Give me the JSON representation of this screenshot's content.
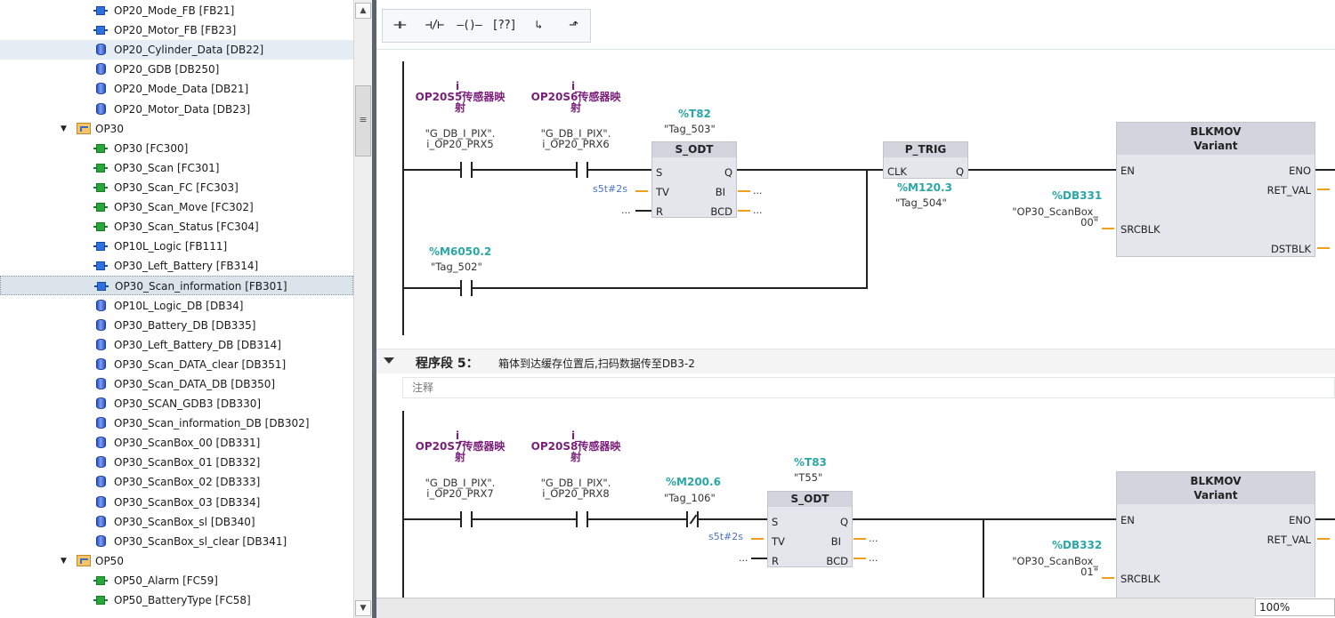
{
  "tree": {
    "items": [
      {
        "label": "OP20_Mode_FB [FB21]",
        "kind": "fb",
        "indent": 1
      },
      {
        "label": "OP20_Motor_FB [FB23]",
        "kind": "fb",
        "indent": 1
      },
      {
        "label": "OP20_Cylinder_Data [DB22]",
        "kind": "db",
        "indent": 1,
        "state": "selected-light"
      },
      {
        "label": "OP20_GDB [DB250]",
        "kind": "db",
        "indent": 1
      },
      {
        "label": "OP20_Mode_Data [DB21]",
        "kind": "db",
        "indent": 1
      },
      {
        "label": "OP20_Motor_Data [DB23]",
        "kind": "db",
        "indent": 1
      },
      {
        "label": "OP30",
        "kind": "folder",
        "indent": 0,
        "expanded": true
      },
      {
        "label": "OP30 [FC300]",
        "kind": "fc",
        "indent": 1
      },
      {
        "label": "OP30_Scan [FC301]",
        "kind": "fc",
        "indent": 1
      },
      {
        "label": "OP30_Scan_FC [FC303]",
        "kind": "fc",
        "indent": 1
      },
      {
        "label": "OP30_Scan_Move [FC302]",
        "kind": "fc",
        "indent": 1
      },
      {
        "label": "OP30_Scan_Status [FC304]",
        "kind": "fc",
        "indent": 1
      },
      {
        "label": "OP10L_Logic [FB111]",
        "kind": "fb",
        "indent": 1
      },
      {
        "label": "OP30_Left_Battery [FB314]",
        "kind": "fb",
        "indent": 1
      },
      {
        "label": "OP30_Scan_information [FB301]",
        "kind": "fb",
        "indent": 1,
        "state": "selected"
      },
      {
        "label": "OP10L_Logic_DB [DB34]",
        "kind": "db",
        "indent": 1
      },
      {
        "label": "OP30_Battery_DB [DB335]",
        "kind": "db",
        "indent": 1
      },
      {
        "label": "OP30_Left_Battery_DB [DB314]",
        "kind": "db",
        "indent": 1
      },
      {
        "label": "OP30_Scan_DATA_clear [DB351]",
        "kind": "db",
        "indent": 1
      },
      {
        "label": "OP30_Scan_DATA_DB [DB350]",
        "kind": "db",
        "indent": 1
      },
      {
        "label": "OP30_SCAN_GDB3 [DB330]",
        "kind": "db",
        "indent": 1
      },
      {
        "label": "OP30_Scan_information_DB [DB302]",
        "kind": "db",
        "indent": 1
      },
      {
        "label": "OP30_ScanBox_00 [DB331]",
        "kind": "db",
        "indent": 1
      },
      {
        "label": "OP30_ScanBox_01 [DB332]",
        "kind": "db",
        "indent": 1
      },
      {
        "label": "OP30_ScanBox_02 [DB333]",
        "kind": "db",
        "indent": 1
      },
      {
        "label": "OP30_ScanBox_03 [DB334]",
        "kind": "db",
        "indent": 1
      },
      {
        "label": "OP30_ScanBox_sl [DB340]",
        "kind": "db",
        "indent": 1
      },
      {
        "label": "OP30_ScanBox_sl_clear [DB341]",
        "kind": "db",
        "indent": 1
      },
      {
        "label": "OP50",
        "kind": "folder",
        "indent": 0,
        "expanded": true
      },
      {
        "label": "OP50_Alarm [FC59]",
        "kind": "fc",
        "indent": 1
      },
      {
        "label": "OP50_BatteryType [FC58]",
        "kind": "fc",
        "indent": 1
      }
    ]
  },
  "toolbar": {
    "buttons": [
      {
        "name": "no-contact-button",
        "glyph": "⊣⊢"
      },
      {
        "name": "nc-contact-button",
        "glyph": "⊣/⊢"
      },
      {
        "name": "coil-button",
        "glyph": "–()–"
      },
      {
        "name": "empty-box-button",
        "glyph": "[??]"
      },
      {
        "name": "open-branch-button",
        "glyph": "↳"
      },
      {
        "name": "close-branch-button",
        "glyph": "⬏"
      }
    ]
  },
  "network4": {
    "c1": {
      "name": "i_",
      "name2": "OP20S5传感器映",
      "name3": "射",
      "addr": "\"G_DB_I_PIX\".",
      "addr2": "i_OP20_PRX5"
    },
    "c2": {
      "name": "i_",
      "name2": "OP20S6传感器映",
      "name3": "射",
      "addr": "\"G_DB_I_PIX\".",
      "addr2": "i_OP20_PRX6"
    },
    "timer": {
      "tag": "%T82",
      "name": "\"Tag_503\"",
      "title": "S_ODT",
      "pin_s": "S",
      "pin_q": "Q",
      "pin_tv": "TV",
      "pin_bi": "BI",
      "pin_r": "R",
      "pin_bcd": "BCD",
      "tv_val": "s5t#2s",
      "dots": "..."
    },
    "ptrig": {
      "title": "P_TRIG",
      "pin_clk": "CLK",
      "pin_q": "Q",
      "tag": "%M120.3",
      "name": "\"Tag_504\""
    },
    "c3": {
      "tag": "%M6050.2",
      "name": "\"Tag_502\""
    },
    "blk": {
      "title": "BLKMOV",
      "subtitle": "Variant",
      "pin_en": "EN",
      "pin_eno": "ENO",
      "pin_ret": "RET_VAL",
      "pin_src": "SRCBLK",
      "pin_dst": "DSTBLK",
      "src_tag": "%DB331",
      "src_name": "\"OP30_ScanBox_",
      "src_name2": "00\""
    }
  },
  "network5": {
    "title": "程序段 5：",
    "desc": "箱体到达缓存位置后,扫码数据传至DB3-2",
    "comment": "注释",
    "c1": {
      "name": "i_",
      "name2": "OP20S7传感器映",
      "name3": "射",
      "addr": "\"G_DB_I_PIX\".",
      "addr2": "i_OP20_PRX7"
    },
    "c2": {
      "name": "i_",
      "name2": "OP20S8传感器映",
      "name3": "射",
      "addr": "\"G_DB_I_PIX\".",
      "addr2": "i_OP20_PRX8"
    },
    "c3": {
      "tag": "%M200.6",
      "name": "\"Tag_106\""
    },
    "timer": {
      "tag": "%T83",
      "name": "\"T55\"",
      "title": "S_ODT",
      "pin_s": "S",
      "pin_q": "Q",
      "pin_tv": "TV",
      "pin_bi": "BI",
      "pin_r": "R",
      "pin_bcd": "BCD",
      "tv_val": "s5t#2s",
      "dots": "..."
    },
    "blk": {
      "title": "BLKMOV",
      "subtitle": "Variant",
      "pin_en": "EN",
      "pin_eno": "ENO",
      "pin_ret": "RET_VAL",
      "pin_src": "SRCBLK",
      "src_tag": "%DB332",
      "src_name": "\"OP30_ScanBox_",
      "src_name2": "01\""
    }
  },
  "zoom": "100%"
}
